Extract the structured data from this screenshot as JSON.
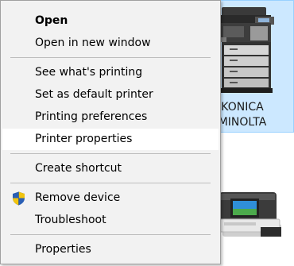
{
  "device_tile": {
    "label_line1": "KONICA",
    "label_line2": "MINOLTA",
    "icon": "multifunction-printer-icon"
  },
  "small_device": {
    "icon": "photo-printer-icon"
  },
  "context_menu": {
    "items": [
      {
        "label": "Open",
        "default": true
      },
      {
        "label": "Open in new window"
      },
      {
        "label": "See what's printing"
      },
      {
        "label": "Set as default printer"
      },
      {
        "label": "Printing preferences"
      },
      {
        "label": "Printer properties",
        "highlighted": true
      },
      {
        "label": "Create shortcut"
      },
      {
        "label": "Remove device",
        "icon": "uac-shield-icon"
      },
      {
        "label": "Troubleshoot"
      },
      {
        "label": "Properties"
      }
    ]
  },
  "colors": {
    "menu_background": "#f2f2f2",
    "menu_highlight": "#ffffff",
    "selection_background": "#cce8ff",
    "selection_border": "#99d1ff"
  }
}
